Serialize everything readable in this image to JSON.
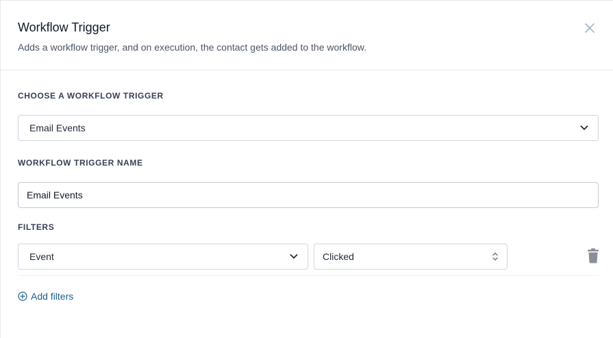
{
  "header": {
    "title": "Workflow Trigger",
    "subtitle": "Adds a workflow trigger, and on execution, the contact gets added to the workflow."
  },
  "trigger": {
    "label": "CHOOSE A WORKFLOW TRIGGER",
    "selected": "Email Events"
  },
  "trigger_name": {
    "label": "WORKFLOW TRIGGER NAME",
    "value": "Email Events"
  },
  "filters": {
    "label": "FILTERS",
    "rows": [
      {
        "field": "Event",
        "value": "Clicked"
      }
    ],
    "add_label": "Add filters"
  },
  "icons": {
    "close": "close-icon",
    "chevron": "chevron-down-icon",
    "updown": "chevron-up-down-icon",
    "trash": "trash-icon",
    "add": "plus-circle-icon"
  },
  "colors": {
    "link": "#1e5f8a",
    "border": "#d1d5db",
    "close_icon": "#a5b4c4",
    "trash_icon": "#8a8f98"
  }
}
